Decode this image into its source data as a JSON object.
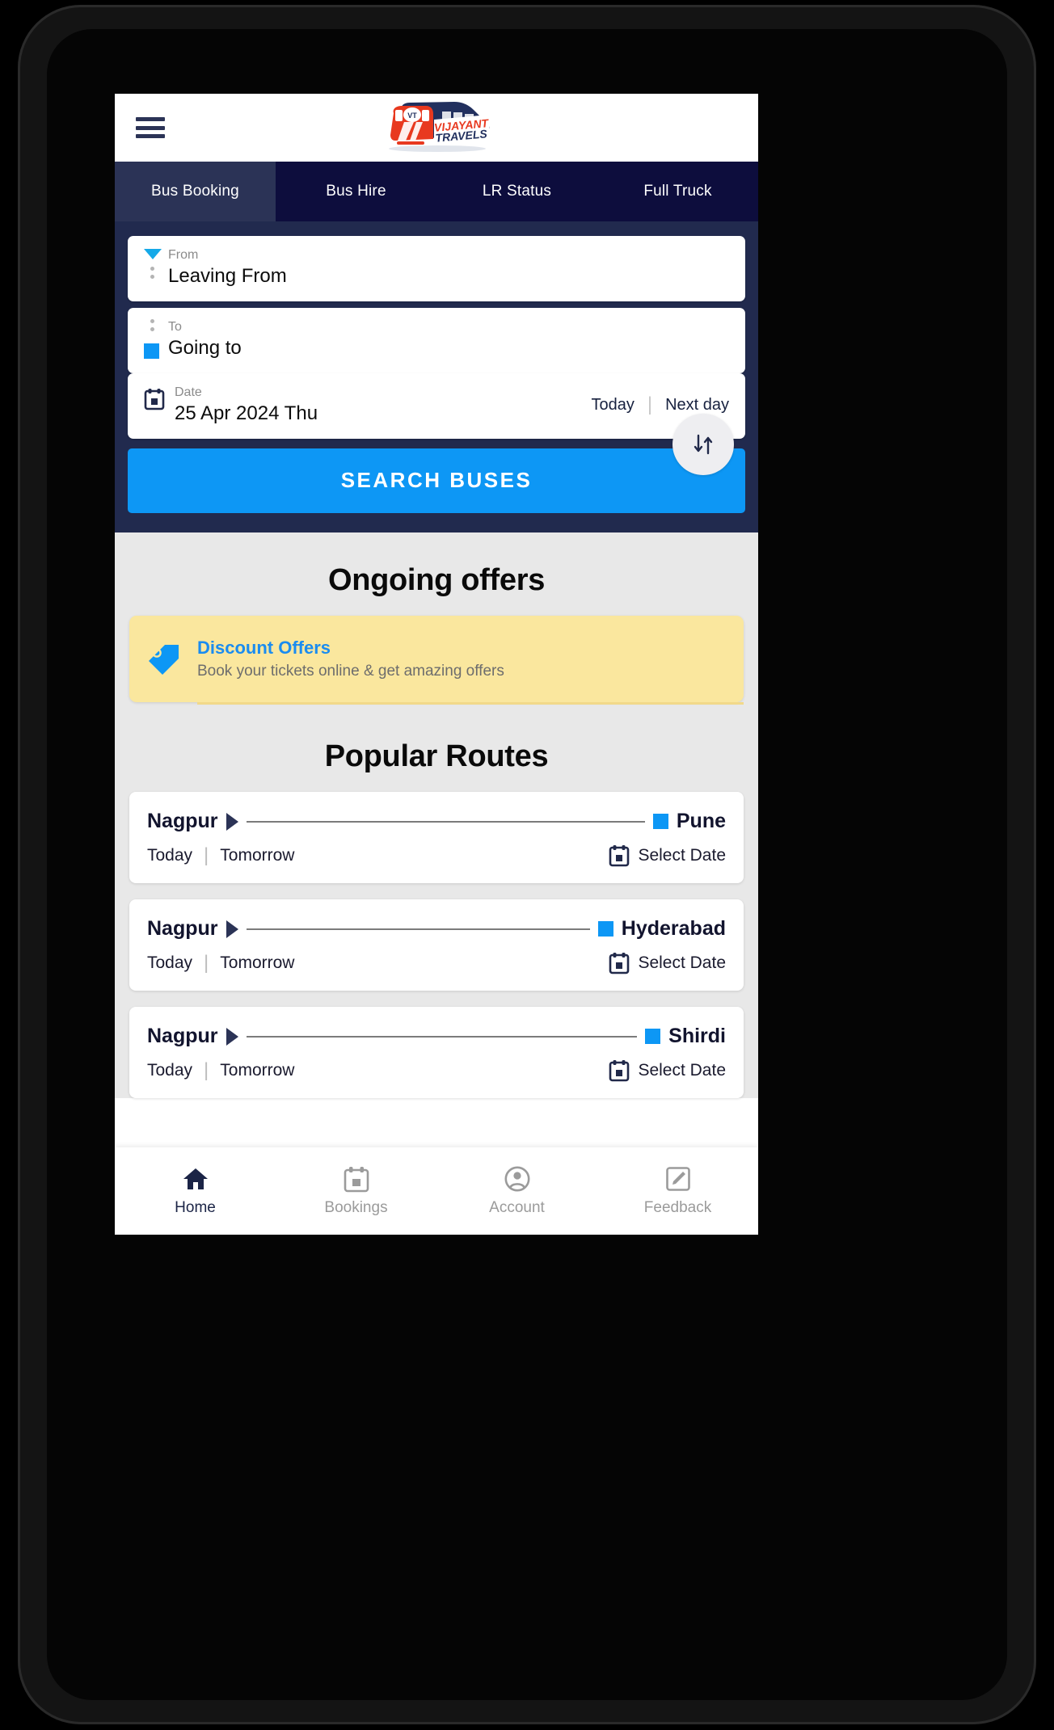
{
  "brand": {
    "name": "VIJAYANT TRAVELS",
    "logo_badge": "VT",
    "logo_line1": "VIJAYANT",
    "logo_line2": "TRAVELS",
    "menu_icon": "hamburger-menu-icon"
  },
  "tabs": [
    {
      "label": "Bus Booking",
      "active": true
    },
    {
      "label": "Bus Hire",
      "active": false
    },
    {
      "label": "LR Status",
      "active": false
    },
    {
      "label": "Full Truck",
      "active": false
    }
  ],
  "search": {
    "from": {
      "label": "From",
      "value": "Leaving From"
    },
    "to": {
      "label": "To",
      "value": "Going to"
    },
    "date": {
      "label": "Date",
      "value": "25 Apr 2024 Thu",
      "quick": [
        "Today",
        "Next day"
      ]
    },
    "swap_icon": "swap-arrows-icon",
    "submit_label": "SEARCH BUSES"
  },
  "offers": {
    "heading": "Ongoing offers",
    "items": [
      {
        "icon": "discount-tag-icon",
        "title": "Discount Offers",
        "subtitle": "Book your tickets online & get amazing offers"
      }
    ]
  },
  "popular_routes": {
    "heading": "Popular Routes",
    "quick_labels": [
      "Today",
      "Tomorrow"
    ],
    "select_date_label": "Select Date",
    "items": [
      {
        "from": "Nagpur",
        "to": "Pune"
      },
      {
        "from": "Nagpur",
        "to": "Hyderabad"
      },
      {
        "from": "Nagpur",
        "to": "Shirdi"
      }
    ]
  },
  "bottom_nav": [
    {
      "label": "Home",
      "icon": "home-icon",
      "active": true
    },
    {
      "label": "Bookings",
      "icon": "bookings-calendar-icon",
      "active": false
    },
    {
      "label": "Account",
      "icon": "account-person-icon",
      "active": false
    },
    {
      "label": "Feedback",
      "icon": "feedback-pencil-icon",
      "active": false
    }
  ],
  "colors": {
    "accent_blue": "#0d97f5",
    "navy_dark": "#0d0d3d",
    "navy_panel": "#212a4e",
    "tab_active": "#2b3356",
    "offer_yellow": "#fae79e",
    "body_grey": "#e8e8e8"
  }
}
